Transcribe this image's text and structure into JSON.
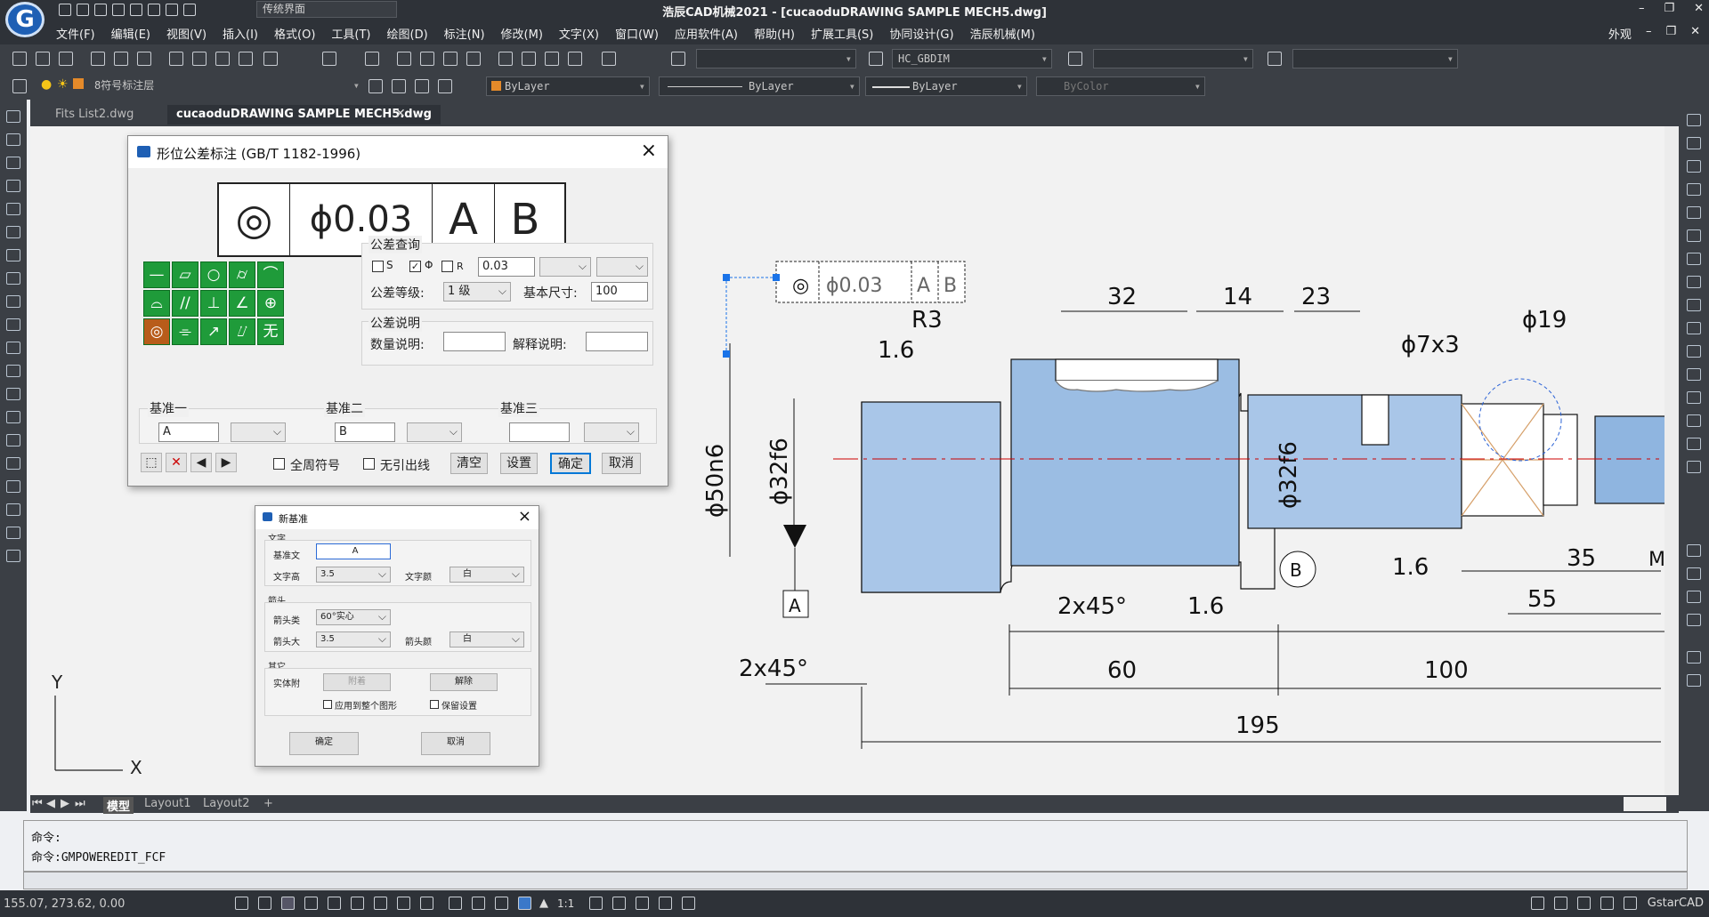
{
  "titlebar": {
    "logo": "G",
    "workspace": "传统界面",
    "title": "浩辰CAD机械2021 - [cucaoduDRAWING SAMPLE MECH5.dwg]",
    "min": "–",
    "restore": "❐",
    "close": "✕"
  },
  "menus": [
    "文件(F)",
    "编辑(E)",
    "视图(V)",
    "插入(I)",
    "格式(O)",
    "工具(T)",
    "绘图(D)",
    "标注(N)",
    "修改(M)",
    "文字(X)",
    "窗口(W)",
    "应用软件(A)",
    "帮助(H)",
    "扩展工具(S)",
    "协同设计(G)",
    "浩辰机械(M)"
  ],
  "menuright": {
    "skin": "外观",
    "min": "–",
    "restore": "❐",
    "close": "✕"
  },
  "toolbar": {
    "textstyle": "HC_GBDIM",
    "layer": "8符号标注层",
    "color": "ByLayer",
    "linetype": "ByLayer",
    "lineweight": "ByLayer",
    "plotstyle": "ByColor"
  },
  "doc_tabs": [
    "Fits List2.dwg",
    "cucaoduDRAWING SAMPLE MECH5.dwg"
  ],
  "layout_tabs": [
    "模型",
    "Layout1",
    "Layout2",
    "+"
  ],
  "command": {
    "line1": "命令:",
    "line2": "命令:GMPOWEREDIT_FCF"
  },
  "status": {
    "coords": "155.07, 273.62, 0.00",
    "scale": "1:1",
    "brand": "GstarCAD"
  },
  "fcf_dialog": {
    "title": "形位公差标注 (GB/T 1182-1996)",
    "frame": {
      "symbol": "◎",
      "tolerance": "ϕ0.03",
      "datum_a": "A",
      "datum_b": "B"
    },
    "symbols": [
      "—",
      "▱",
      "○",
      "⌭",
      "⌒",
      "⌓",
      "//",
      "⊥",
      "∠",
      "⊕",
      "◎",
      "⌯",
      "↗",
      "⌰",
      "无"
    ],
    "tolerance_group": "公差查询",
    "chk_s": "S",
    "chk_phi": "Φ",
    "chk_r": "R",
    "tol_value": "0.03",
    "grade_label": "公差等级:",
    "grade_value": "1 级",
    "basic_label": "基本尺寸:",
    "basic_value": "100",
    "desc_group": "公差说明",
    "qty_label": "数量说明:",
    "explain_label": "解释说明:",
    "datum1_label": "基准一",
    "datum1_value": "A",
    "datum2_label": "基准二",
    "datum2_value": "B",
    "datum3_label": "基准三",
    "all_around": "全周符号",
    "no_leader": "无引出线",
    "clear": "清空",
    "settings": "设置",
    "ok": "确定",
    "cancel": "取消"
  },
  "datum_dialog": {
    "title": "新基准",
    "text_group": "文字",
    "base_text_label": "基准文",
    "base_text_value": "A",
    "text_height_label": "文字高",
    "text_height_value": "3.5",
    "text_color_label": "文字颜",
    "text_color_value": "白",
    "arrow_group": "箭头",
    "arrow_type_label": "箭头类",
    "arrow_type_value": "60°实心",
    "arrow_size_label": "箭头大",
    "arrow_size_value": "3.5",
    "arrow_color_label": "箭头颜",
    "arrow_color_value": "白",
    "other_group": "其它",
    "entity_label": "实体附",
    "attach": "附着",
    "detach": "解除",
    "apply_all": "应用到整个图形",
    "keep_settings": "保留设置",
    "ok": "确定",
    "cancel": "取消"
  },
  "drawing": {
    "fcf_symbol": "◎",
    "fcf_tol": "ϕ0.03",
    "fcf_a": "A",
    "fcf_b": "B",
    "dims": {
      "d32": "32",
      "d14": "14",
      "d23": "23",
      "r3": "R3",
      "phi19": "ϕ19",
      "phi7x3": "ϕ7x3",
      "phi50n6": "ϕ50n6",
      "phi32f6a": "ϕ32f6",
      "phi32f6b": "ϕ32f6",
      "rough1": "1.6",
      "rough2": "1.6",
      "rough3": "1.6",
      "ch1": "2x45°",
      "ch2": "2x45°",
      "d35": "35",
      "d55": "55",
      "d60": "60",
      "d100": "100",
      "d195": "195",
      "datum_a": "A",
      "datum_b": "B",
      "m": "M"
    },
    "ucs_y": "Y",
    "ucs_x": "X"
  }
}
